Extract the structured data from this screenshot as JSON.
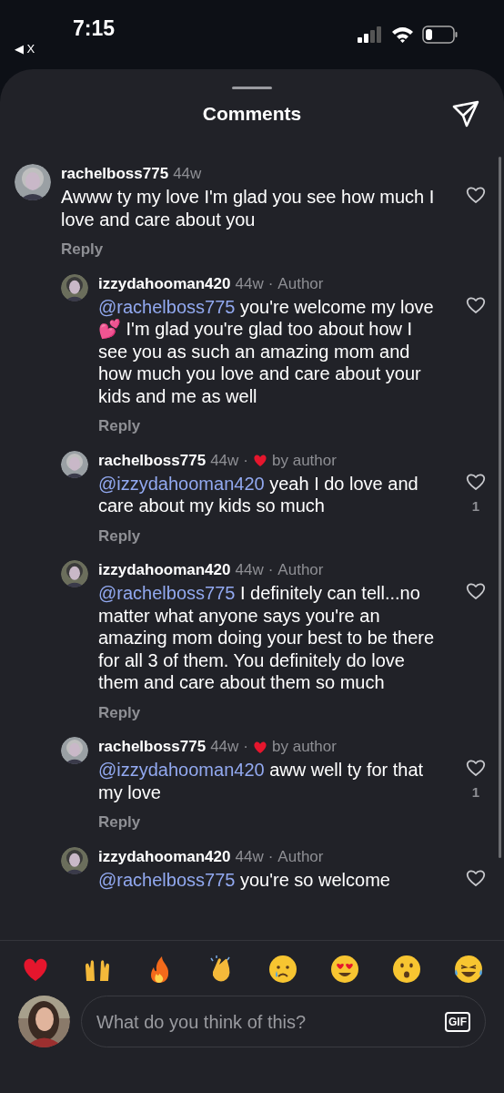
{
  "status_bar": {
    "time": "7:15",
    "back_label": "◀ X"
  },
  "sheet": {
    "title": "Comments"
  },
  "comments": [
    {
      "user": "rachelboss775",
      "age": "44w",
      "text": "Awww ty my love I'm glad you see how much I love and care about you",
      "reply_label": "Reply",
      "children": [
        {
          "user": "izzydahooman420",
          "age": "44w",
          "badge": {
            "kind": "author",
            "separator": "·",
            "label": "Author"
          },
          "mention": "@rachelboss775",
          "text": "you're welcome my love 💕 I'm glad you're glad too about how I see you as such an amazing mom and how much you love and care about your kids and me as well",
          "reply_label": "Reply"
        },
        {
          "user": "rachelboss775",
          "age": "44w",
          "badge": {
            "kind": "liked_by_author",
            "separator": "·",
            "label": "by author"
          },
          "mention": "@izzydahooman420",
          "text": "yeah I do love and care about my kids so much",
          "likes": "1",
          "reply_label": "Reply"
        },
        {
          "user": "izzydahooman420",
          "age": "44w",
          "badge": {
            "kind": "author",
            "separator": "·",
            "label": "Author"
          },
          "mention": "@rachelboss775",
          "text": "I definitely can tell...no matter what anyone says you're an amazing mom doing your best to be there for all 3 of them. You definitely do love them and care about them so much",
          "reply_label": "Reply"
        },
        {
          "user": "rachelboss775",
          "age": "44w",
          "badge": {
            "kind": "liked_by_author",
            "separator": "·",
            "label": "by author"
          },
          "mention": "@izzydahooman420",
          "text": "aww well ty for that my love",
          "likes": "1",
          "reply_label": "Reply"
        },
        {
          "user": "izzydahooman420",
          "age": "44w",
          "badge": {
            "kind": "author",
            "separator": "·",
            "label": "Author"
          },
          "mention": "@rachelboss775",
          "text": "you're so welcome"
        }
      ]
    }
  ],
  "composer": {
    "placeholder": "What do you think of this?",
    "gif_label": "GIF"
  }
}
